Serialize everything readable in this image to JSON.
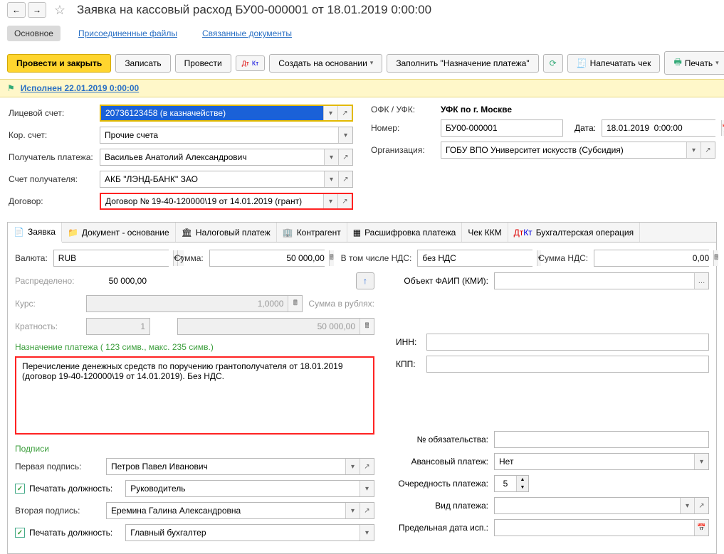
{
  "title": "Заявка на кассовый расход БУ00-000001 от 18.01.2019 0:00:00",
  "top_tabs": {
    "main": "Основное",
    "files": "Присоединенные файлы",
    "related": "Связанные документы"
  },
  "actions": {
    "post_close": "Провести и закрыть",
    "save": "Записать",
    "post": "Провести",
    "create_based": "Создать на основании",
    "fill_purpose": "Заполнить \"Назначение платежа\"",
    "print_check": "Напечатать чек",
    "print": "Печать"
  },
  "status": "Исполнен 22.01.2019 0:00:00",
  "form": {
    "personal_account_label": "Лицевой счет:",
    "personal_account": "20736123458 (в казначействе)",
    "cor_account_label": "Кор. счет:",
    "cor_account": "Прочие счета",
    "recipient_label": "Получатель платежа:",
    "recipient": "Васильев Анатолий Александрович",
    "recipient_acc_label": "Счет получателя:",
    "recipient_acc": "АКБ \"ЛЭНД-БАНК\" ЗАО",
    "contract_label": "Договор:",
    "contract": "Договор № 19-40-120000\\19 от 14.01.2019 (грант)",
    "ofk_label": "ОФК / УФК:",
    "ofk": "УФК по г. Москве",
    "number_label": "Номер:",
    "number": "БУ00-000001",
    "date_label": "Дата:",
    "date": "18.01.2019  0:00:00",
    "org_label": "Организация:",
    "org": "ГОБУ ВПО Университет искусств (Субсидия)"
  },
  "tabs": {
    "app": "Заявка",
    "doc": "Документ - основание",
    "tax": "Налоговый платеж",
    "ka": "Контрагент",
    "ras": "Расшифровка платежа",
    "kkm": "Чек ККМ",
    "buh": "Бухгалтерская операция"
  },
  "app_tab": {
    "currency_label": "Валюта:",
    "currency": "RUB",
    "sum_label": "Сумма:",
    "sum": "50 000,00",
    "vat_incl_label": "В том числе НДС:",
    "vat_type": "без НДС",
    "vat_sum_label": "Сумма НДС:",
    "vat_sum": "0,00",
    "distributed_label": "Распределено:",
    "distributed": "50 000,00",
    "faip_label": "Объект ФАИП (КМИ):",
    "rate_label": "Курс:",
    "rate": "1,0000",
    "rub_sum_label": "Сумма в рублях:",
    "rub_sum": "50 000,00",
    "mult_label": "Кратность:",
    "mult": "1",
    "purpose_title": "Назначение платежа ( 123 симв., макс. 235 симв.)",
    "purpose_text": "Перечисление денежных средств по поручению грантополучателя от 18.01.2019 (договор 19-40-120000\\19 от 14.01.2019). Без НДС.",
    "inn": "ИНН:",
    "kpp": "КПП:",
    "signs_title": "Подписи",
    "obligation_label": "№ обязательства:",
    "sign1_label": "Первая подпись:",
    "sign1": "Петров Павел Иванович",
    "advance_label": "Авансовый платеж:",
    "advance": "Нет",
    "print_pos1_label": "Печатать должность:",
    "pos1": "Руководитель",
    "priority_label": "Очередность платежа:",
    "priority": "5",
    "sign2_label": "Вторая подпись:",
    "sign2": "Еремина Галина Александровна",
    "pay_type_label": "Вид платежа:",
    "print_pos2_label": "Печатать должность:",
    "pos2": "Главный бухгалтер",
    "limit_date_label": "Предельная дата исп.:"
  }
}
